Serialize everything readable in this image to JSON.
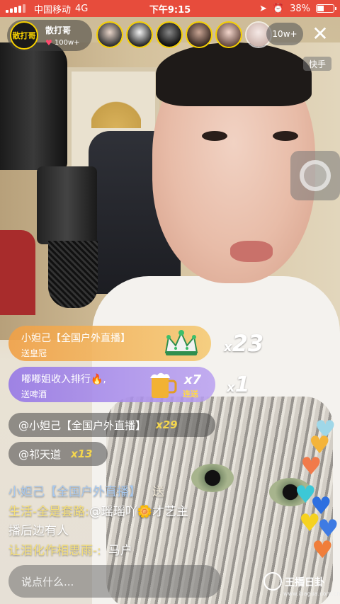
{
  "status_bar": {
    "carrier": "中国移动",
    "network": "4G",
    "time": "下午9:15",
    "battery": "38%",
    "battery_level": 0.38
  },
  "host": {
    "avatar_text": "散打哥",
    "name": "散打哥",
    "likes": "100w+"
  },
  "viewer_count": "10w+",
  "brand_tag": "快手",
  "gifts": [
    {
      "sender": "小妲己【全国户外直播】",
      "action": "送皇冠",
      "combo_x": "x",
      "combo": "23"
    },
    {
      "sender": "嘟嘟姐收入排行🔥,",
      "action": "送啤酒",
      "count": "x7",
      "tag": "连送",
      "combo_x": "x",
      "combo": "1"
    }
  ],
  "chats": [
    {
      "text": "@小妲己【全国户外直播】",
      "mult": "x29"
    },
    {
      "text": "@祁天道",
      "mult": "x13"
    }
  ],
  "messages": {
    "m1_user": "小妲己【全国户外直播】",
    "m1_action": "送",
    "m2_user": "生活-全是套路:",
    "m2_text_a": "@瑶瑶吖",
    "m2_flower": "🌼",
    "m2_text_b": "才艺主",
    "m3_text": "播后边有人",
    "m4_user": "让泪化作相思雨-:",
    "m4_text": "马户"
  },
  "input": {
    "placeholder": "说点什么..."
  },
  "watermark": {
    "text": "王播日卦",
    "url": "www.ibagua.com.cn"
  },
  "colors": {
    "status_red": "#e74c3c",
    "gold_border": "#f6d000",
    "combo_yellow": "#f4d64e"
  }
}
